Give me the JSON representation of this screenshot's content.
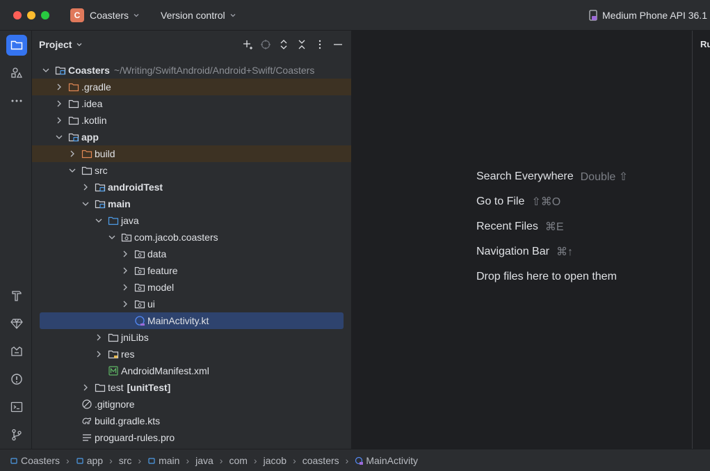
{
  "titlebar": {
    "project_badge": "C",
    "project_name": "Coasters",
    "version_control": "Version control",
    "device": "Medium Phone API 36.1"
  },
  "project_panel": {
    "title": "Project",
    "tree": [
      {
        "label": "Coasters",
        "path": "~/Writing/SwiftAndroid/Android+Swift/Coasters",
        "depth": 0,
        "arrow": "down",
        "icon": "module-folder",
        "bold": true
      },
      {
        "label": ".gradle",
        "depth": 1,
        "arrow": "right",
        "icon": "folder-excluded",
        "excluded": true
      },
      {
        "label": ".idea",
        "depth": 1,
        "arrow": "right",
        "icon": "folder"
      },
      {
        "label": ".kotlin",
        "depth": 1,
        "arrow": "right",
        "icon": "folder"
      },
      {
        "label": "app",
        "depth": 1,
        "arrow": "down",
        "icon": "module-folder",
        "bold": true
      },
      {
        "label": "build",
        "depth": 2,
        "arrow": "right",
        "icon": "folder-excluded",
        "excluded": true
      },
      {
        "label": "src",
        "depth": 2,
        "arrow": "down",
        "icon": "folder"
      },
      {
        "label": "androidTest",
        "depth": 3,
        "arrow": "right",
        "icon": "module-folder",
        "bold": true
      },
      {
        "label": "main",
        "depth": 3,
        "arrow": "down",
        "icon": "module-folder",
        "bold": true
      },
      {
        "label": "java",
        "depth": 4,
        "arrow": "down",
        "icon": "source-folder"
      },
      {
        "label": "com.jacob.coasters",
        "depth": 5,
        "arrow": "down",
        "icon": "package"
      },
      {
        "label": "data",
        "depth": 6,
        "arrow": "right",
        "icon": "package"
      },
      {
        "label": "feature",
        "depth": 6,
        "arrow": "right",
        "icon": "package"
      },
      {
        "label": "model",
        "depth": 6,
        "arrow": "right",
        "icon": "package"
      },
      {
        "label": "ui",
        "depth": 6,
        "arrow": "right",
        "icon": "package"
      },
      {
        "label": "MainActivity.kt",
        "depth": 6,
        "arrow": "none",
        "icon": "kotlin-class",
        "selected": true
      },
      {
        "label": "jniLibs",
        "depth": 4,
        "arrow": "right",
        "icon": "folder"
      },
      {
        "label": "res",
        "depth": 4,
        "arrow": "right",
        "icon": "resource-folder"
      },
      {
        "label": "AndroidManifest.xml",
        "depth": 4,
        "arrow": "none",
        "icon": "manifest-file"
      },
      {
        "label": "test",
        "label_suffix": "[unitTest]",
        "depth": 3,
        "arrow": "right",
        "icon": "folder"
      },
      {
        "label": ".gitignore",
        "depth": 2,
        "arrow": "none",
        "icon": "ignore-file"
      },
      {
        "label": "build.gradle.kts",
        "depth": 2,
        "arrow": "none",
        "icon": "gradle-file"
      },
      {
        "label": "proguard-rules.pro",
        "depth": 2,
        "arrow": "none",
        "icon": "text-file"
      }
    ]
  },
  "editor": {
    "hints": [
      {
        "label": "Search Everywhere",
        "shortcut": "Double ⇧"
      },
      {
        "label": "Go to File",
        "shortcut": "⇧⌘O"
      },
      {
        "label": "Recent Files",
        "shortcut": "⌘E"
      },
      {
        "label": "Navigation Bar",
        "shortcut": "⌘↑"
      },
      {
        "label": "Drop files here to open them",
        "shortcut": ""
      }
    ]
  },
  "right_panel": {
    "label": "Ru"
  },
  "breadcrumbs": [
    {
      "label": "Coasters",
      "icon": "module-icon"
    },
    {
      "label": "app",
      "icon": "module-icon"
    },
    {
      "label": "src",
      "icon": ""
    },
    {
      "label": "main",
      "icon": "module-icon"
    },
    {
      "label": "java",
      "icon": ""
    },
    {
      "label": "com",
      "icon": ""
    },
    {
      "label": "jacob",
      "icon": ""
    },
    {
      "label": "coasters",
      "icon": ""
    },
    {
      "label": "MainActivity",
      "icon": "kotlin-class-icon"
    }
  ],
  "colors": {
    "accent": "#3574f0",
    "selection": "#2e436e",
    "excluded": "#3d3223",
    "badge": "#e0795b"
  }
}
